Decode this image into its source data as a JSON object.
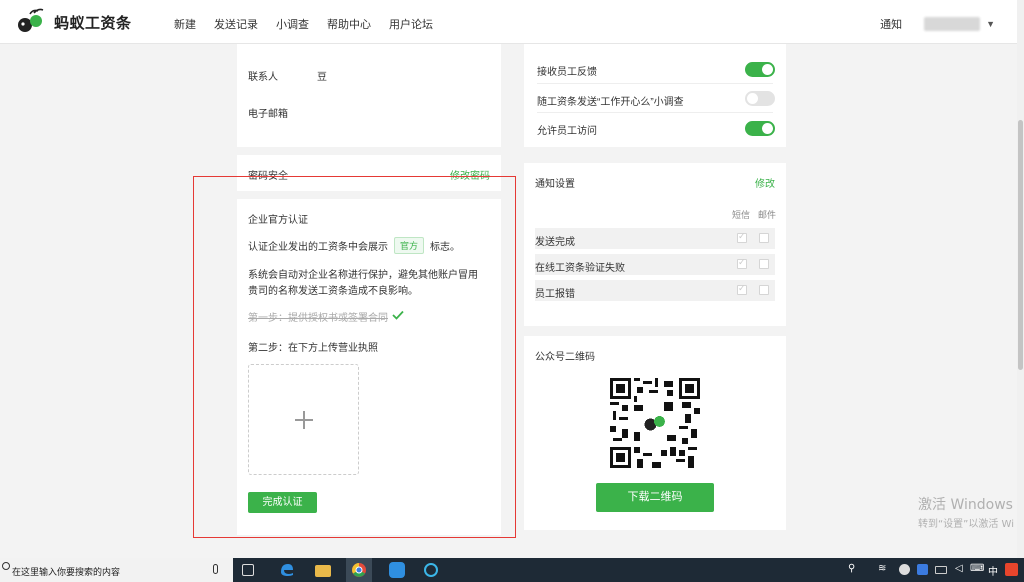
{
  "header": {
    "logo_text_black": "蚂蚁",
    "logo_text_green": "工资条",
    "nav": [
      "新建",
      "发送记录",
      "小调查",
      "帮助中心",
      "用户论坛"
    ],
    "notice": "通知",
    "caret": "▼"
  },
  "contact_card": {
    "contact_label": "联系人",
    "contact_value": "豆",
    "email_label": "电子邮箱"
  },
  "password_card": {
    "label": "密码安全",
    "action": "修改密码"
  },
  "cert_card": {
    "title": "企业官方认证",
    "line1_prefix": "认证企业发出的工资条中会展示",
    "badge": "官方",
    "line1_suffix": "标志。",
    "desc_line1": "系统会自动对企业名称进行保护，避免其他账户冒用",
    "desc_line2": "贵司的名称发送工资条造成不良影响。",
    "step1": "第一步：提供授权书或签署合同",
    "step2": "第二步：在下方上传营业执照",
    "upload_symbol": "+",
    "submit_label": "完成认证"
  },
  "toggles": [
    {
      "label": "接收员工反馈",
      "on": true
    },
    {
      "label": "随工资条发送“工作开心么”小调查",
      "on": false
    },
    {
      "label": "允许员工访问",
      "on": true
    }
  ],
  "notify_card": {
    "title": "通知设置",
    "action": "修改",
    "col_sms": "短信",
    "col_mail": "邮件",
    "rows": [
      {
        "label": "发送完成",
        "sms": true,
        "mail": false
      },
      {
        "label": "在线工资条验证失败",
        "sms": true,
        "mail": false
      },
      {
        "label": "员工报错",
        "sms": true,
        "mail": false
      }
    ]
  },
  "qr_card": {
    "title": "公众号二维码",
    "download_label": "下载二维码"
  },
  "watermark": {
    "line1": "激活 Windows",
    "line2": "转到“设置”以激活 Wi"
  },
  "taskbar": {
    "search_placeholder": "在这里输入你要搜索的内容",
    "ime": "中"
  },
  "colors": {
    "brand_green": "#3bb24a",
    "highlight_red": "#e53935"
  }
}
